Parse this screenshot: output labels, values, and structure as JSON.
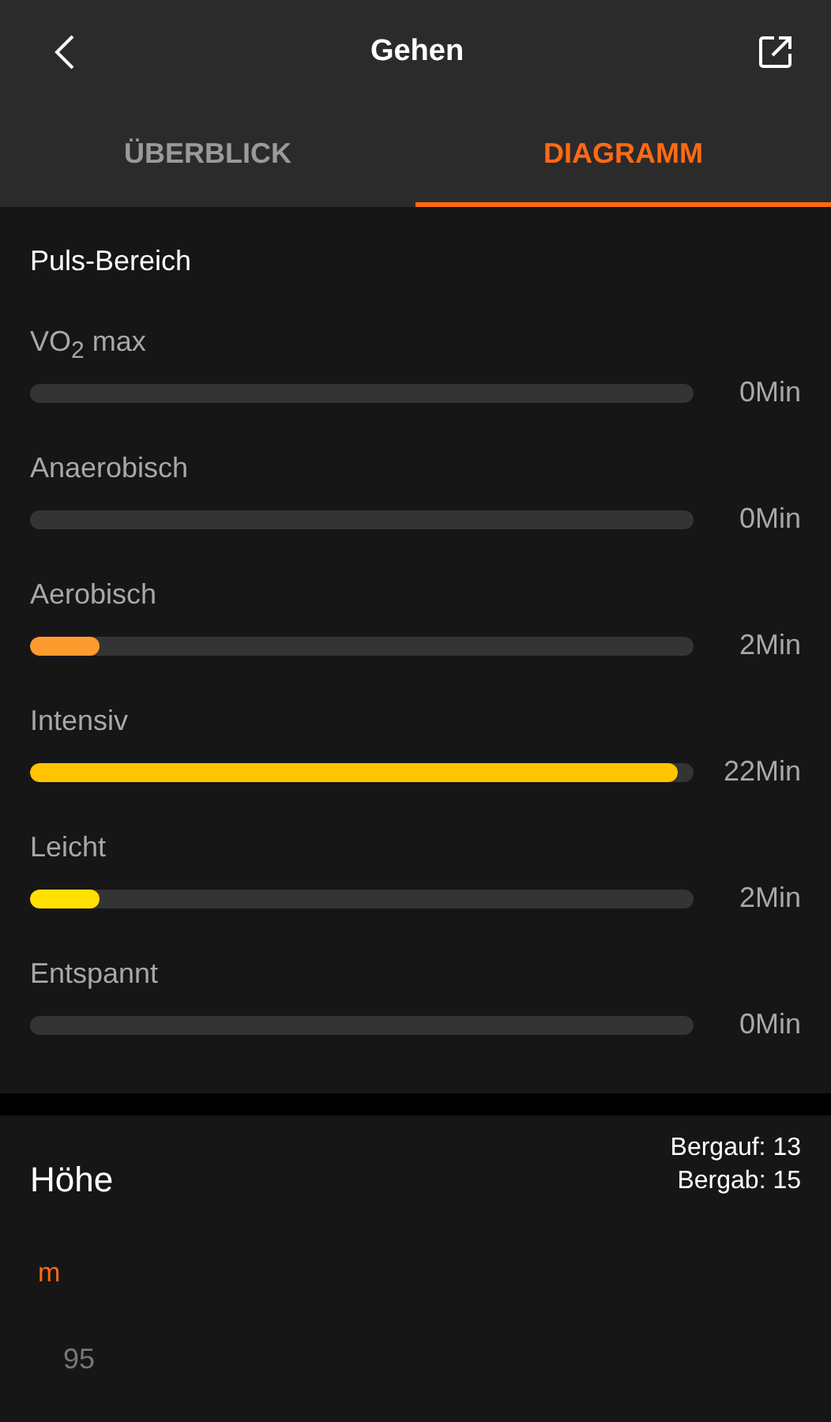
{
  "header": {
    "title": "Gehen"
  },
  "tabs": [
    {
      "label": "ÜBERBLICK",
      "selected": false
    },
    {
      "label": "DIAGRAMM",
      "selected": true
    }
  ],
  "heart_rate_zones": {
    "title": "Puls-Bereich",
    "zones": [
      {
        "name": "VO$_{2}$ max",
        "reading": "0Min"
      },
      {
        "name": "Anaerobisch",
        "reading": "0Min"
      },
      {
        "name": "Aerobisch",
        "level": 0.105,
        "reading": "2Min",
        "color": "#ff9a2e"
      },
      {
        "name": "Intensiv",
        "level": 0.977,
        "reading": "22Min",
        "color": "#ffc300"
      },
      {
        "name": "Leicht",
        "level": 0.105,
        "reading": "2Min",
        "color": "#ffe000"
      },
      {
        "name": "Entspannt",
        "reading": "0Min"
      }
    ]
  },
  "altitude": {
    "title": "Höhe",
    "uphill": "Bergauf: 13",
    "downhill": "Bergab: 15",
    "unit": "m",
    "tick_label": "95"
  }
}
